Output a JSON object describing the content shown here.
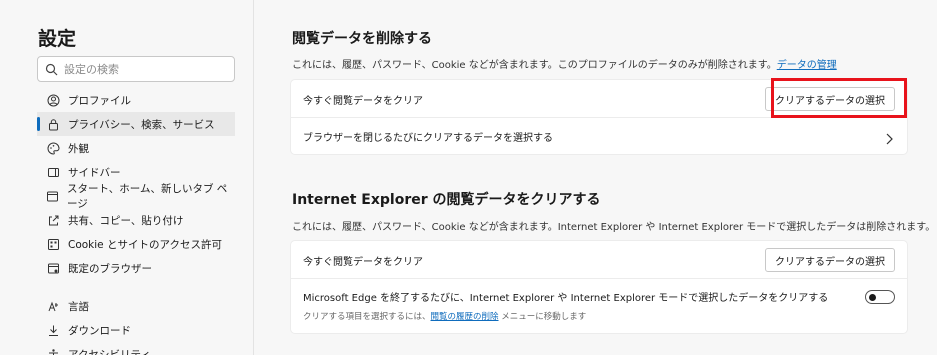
{
  "sidebar": {
    "title": "設定",
    "search_placeholder": "設定の検索",
    "items": [
      {
        "label": "プロファイル",
        "icon": "profile-icon"
      },
      {
        "label": "プライバシー、検索、サービス",
        "icon": "lock-icon",
        "active": true
      },
      {
        "label": "外観",
        "icon": "appearance-icon"
      },
      {
        "label": "サイドバー",
        "icon": "sidebar-icon"
      },
      {
        "label": "スタート、ホーム、新しいタブ ページ",
        "icon": "home-icon"
      },
      {
        "label": "共有、コピー、貼り付け",
        "icon": "share-icon"
      },
      {
        "label": "Cookie とサイトのアクセス許可",
        "icon": "cookie-icon"
      },
      {
        "label": "既定のブラウザー",
        "icon": "browser-icon"
      },
      {
        "label": "言語",
        "icon": "language-icon"
      },
      {
        "label": "ダウンロード",
        "icon": "download-icon"
      },
      {
        "label": "アクセシビリティ",
        "icon": "accessibility-icon"
      }
    ]
  },
  "clear_data": {
    "heading": "閲覧データを削除する",
    "description": "これには、履歴、パスワード、Cookie などが含まれます。このプロファイルのデータのみが削除されます。",
    "manage_link": "データの管理",
    "row1_label": "今すぐ閲覧データをクリア",
    "row1_button": "クリアするデータの選択",
    "row2_label": "ブラウザーを閉じるたびにクリアするデータを選択する"
  },
  "ie_data": {
    "heading": "Internet Explorer の閲覧データをクリアする",
    "description": "これには、履歴、パスワード、Cookie などが含まれます。Internet Explorer や Internet Explorer モードで選択したデータは削除されます。",
    "row1_label": "今すぐ閲覧データをクリア",
    "row1_button": "クリアするデータの選択",
    "row2_label": "Microsoft Edge を終了するたびに、Internet Explorer や Internet Explorer モードで選択したデータをクリアする",
    "row2_sub_prefix": "クリアする項目を選択するには、",
    "row2_sub_link": "閲覧の履歴の削除",
    "row2_sub_suffix": " メニューに移動します",
    "toggle_on": false
  },
  "colors": {
    "accent": "#0f6cbd",
    "highlight": "#e8131b"
  }
}
